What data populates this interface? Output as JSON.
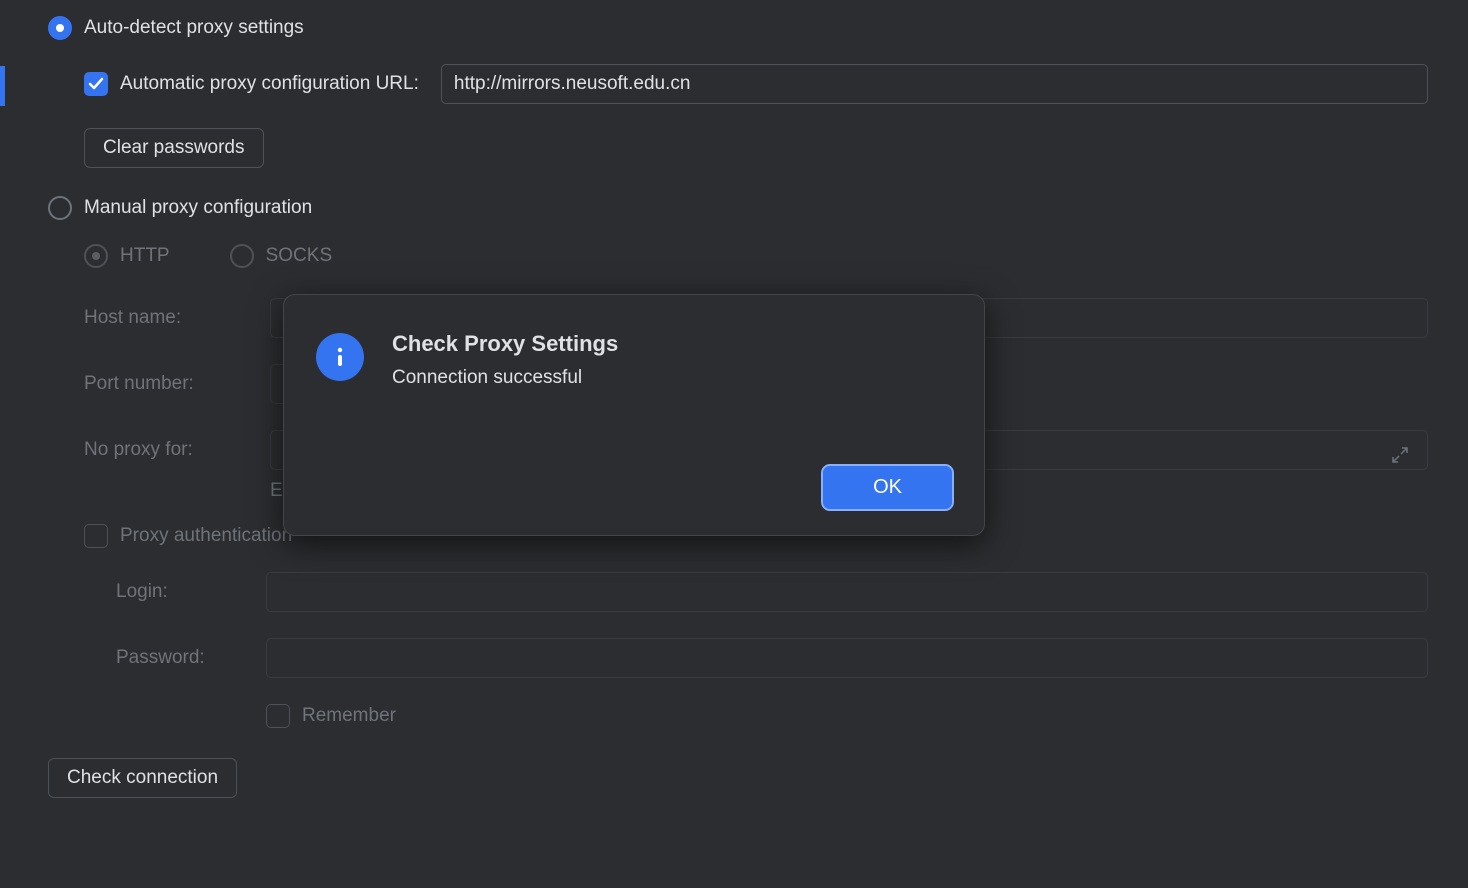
{
  "proxy": {
    "auto_detect_label": "Auto-detect proxy settings",
    "auto_config_url_label": "Automatic proxy configuration URL:",
    "auto_config_url_value": "http://mirrors.neusoft.edu.cn",
    "clear_passwords_label": "Clear passwords",
    "manual_label": "Manual proxy configuration",
    "http_label": "HTTP",
    "socks_label": "SOCKS",
    "host_label": "Host name:",
    "port_label": "Port number:",
    "noproxy_label": "No proxy for:",
    "example_prefix": "E",
    "auth_label": "Proxy authentication",
    "login_label": "Login:",
    "password_label": "Password:",
    "remember_label": "Remember",
    "check_connection_label": "Check connection"
  },
  "dialog": {
    "title": "Check Proxy Settings",
    "message": "Connection successful",
    "ok_label": "OK"
  }
}
